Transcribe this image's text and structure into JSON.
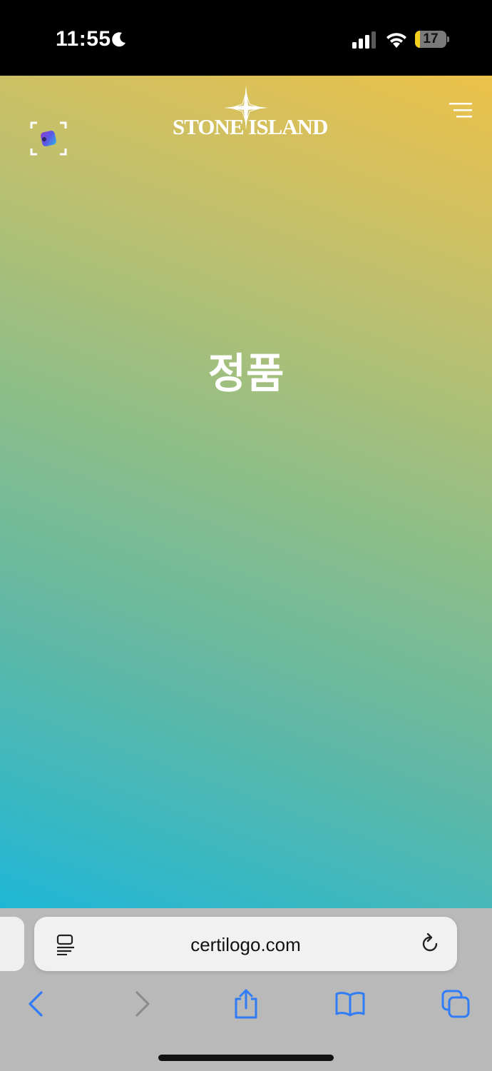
{
  "status_bar": {
    "time": "11:55",
    "battery_level": "17",
    "battery_fraction": 0.17,
    "icons": [
      "moon-icon",
      "signal-icon",
      "wifi-icon",
      "battery-icon"
    ]
  },
  "page": {
    "logo_text": "STONE ISLAND",
    "headline": "정품",
    "gradient_colors": [
      "#ecc14a",
      "#8ebe88",
      "#1fb7d6"
    ],
    "icons": [
      "scan-icon",
      "compass-star-icon",
      "menu-icon"
    ]
  },
  "browser": {
    "url": "certilogo.com",
    "accent_color": "#2f7cf6",
    "icons": [
      "reader-icon",
      "reload-icon",
      "back-icon",
      "forward-icon",
      "share-icon",
      "bookmarks-icon",
      "tabs-icon"
    ]
  }
}
